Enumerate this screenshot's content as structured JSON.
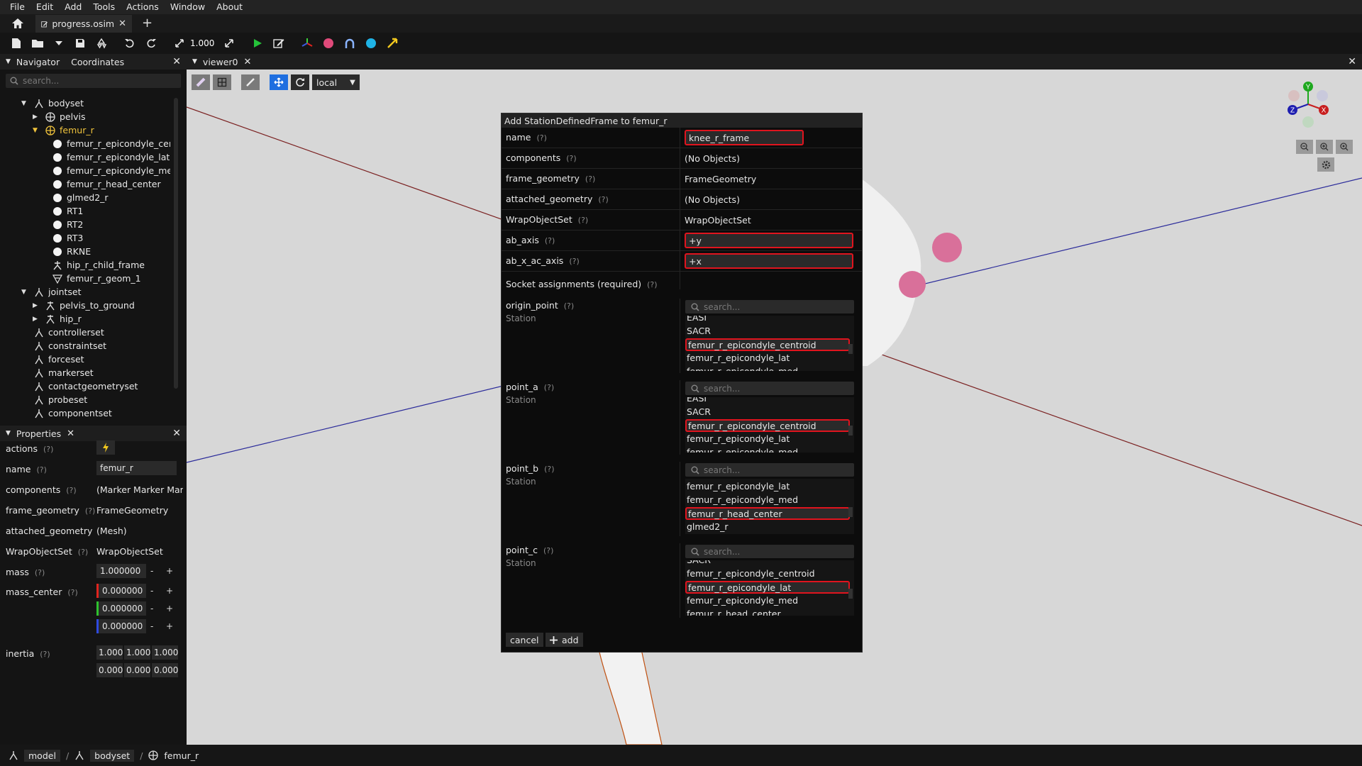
{
  "menu": [
    "File",
    "Edit",
    "Add",
    "Tools",
    "Actions",
    "Window",
    "About"
  ],
  "tab": {
    "name": "progress.osim"
  },
  "toolbar": {
    "scale_value": "1.000"
  },
  "navigator": {
    "title": "Navigator",
    "second_tab": "Coordinates",
    "search_placeholder": "search...",
    "tree": [
      {
        "label": "bodyset",
        "level": 0,
        "arrow": "down",
        "icon": "set"
      },
      {
        "label": "pelvis",
        "level": 1,
        "arrow": "right",
        "icon": "body"
      },
      {
        "label": "femur_r",
        "level": 1,
        "arrow": "down",
        "icon": "body",
        "selected": true
      },
      {
        "label": "femur_r_epicondyle_centroid",
        "level": 2,
        "icon": "marker"
      },
      {
        "label": "femur_r_epicondyle_lat",
        "level": 2,
        "icon": "marker"
      },
      {
        "label": "femur_r_epicondyle_med",
        "level": 2,
        "icon": "marker"
      },
      {
        "label": "femur_r_head_center",
        "level": 2,
        "icon": "marker"
      },
      {
        "label": "glmed2_r",
        "level": 2,
        "icon": "marker"
      },
      {
        "label": "RT1",
        "level": 2,
        "icon": "marker"
      },
      {
        "label": "RT2",
        "level": 2,
        "icon": "marker"
      },
      {
        "label": "RT3",
        "level": 2,
        "icon": "marker"
      },
      {
        "label": "RKNE",
        "level": 2,
        "icon": "marker"
      },
      {
        "label": "hip_r_child_frame",
        "level": 2,
        "icon": "frame"
      },
      {
        "label": "femur_r_geom_1",
        "level": 2,
        "icon": "mesh"
      },
      {
        "label": "jointset",
        "level": 0,
        "arrow": "down",
        "icon": "set"
      },
      {
        "label": "pelvis_to_ground",
        "level": 1,
        "arrow": "right",
        "icon": "joint"
      },
      {
        "label": "hip_r",
        "level": 1,
        "arrow": "right",
        "icon": "joint"
      },
      {
        "label": "controllerset",
        "level": 0,
        "icon": "set"
      },
      {
        "label": "constraintset",
        "level": 0,
        "icon": "set"
      },
      {
        "label": "forceset",
        "level": 0,
        "icon": "set"
      },
      {
        "label": "markerset",
        "level": 0,
        "icon": "set"
      },
      {
        "label": "contactgeometryset",
        "level": 0,
        "icon": "set"
      },
      {
        "label": "probeset",
        "level": 0,
        "icon": "set"
      },
      {
        "label": "componentset",
        "level": 0,
        "icon": "set"
      }
    ]
  },
  "properties": {
    "title": "Properties",
    "help": "(?)",
    "rows": {
      "actions": "actions",
      "name": "name",
      "name_value": "femur_r",
      "components": "components",
      "components_value": "(Marker Marker Mark",
      "frame_geometry": "frame_geometry",
      "frame_geometry_value": "FrameGeometry",
      "attached_geometry": "attached_geometry",
      "attached_geometry_value": "(Mesh)",
      "wrap": "WrapObjectSet",
      "wrap_value": "WrapObjectSet",
      "mass": "mass",
      "mass_value": "1.000000",
      "mass_center": "mass_center",
      "mc_x": "0.000000",
      "mc_y": "0.000000",
      "mc_z": "0.000000",
      "inertia": "inertia",
      "inertia_values": [
        "1.000",
        "1.000",
        "1.000",
        "0.000",
        "0.000",
        "0.000"
      ]
    },
    "minus": "-",
    "plus": "+"
  },
  "viewer": {
    "title": "viewer0",
    "frame_mode": "local"
  },
  "dialog": {
    "title": "Add StationDefinedFrame to femur_r",
    "help": "(?)",
    "fields": [
      {
        "label": "name",
        "value": "knee_r_frame",
        "input": true
      },
      {
        "label": "components",
        "value": "(No Objects)"
      },
      {
        "label": "frame_geometry",
        "value": "FrameGeometry"
      },
      {
        "label": "attached_geometry",
        "value": "(No Objects)"
      },
      {
        "label": "WrapObjectSet",
        "value": "WrapObjectSet"
      },
      {
        "label": "ab_axis",
        "value": "+y",
        "input": true
      },
      {
        "label": "ab_x_ac_axis",
        "value": "+x",
        "input": true
      }
    ],
    "socket_header": "Socket assignments (required)",
    "search_placeholder": "search...",
    "station_label": "Station",
    "sockets": [
      {
        "label": "origin_point",
        "items": [
          "EASI",
          "SACR",
          "femur_r_epicondyle_centroid",
          "femur_r_epicondyle_lat",
          "femur_r_epicondyle_med"
        ],
        "selected": 2,
        "offset": -6
      },
      {
        "label": "point_a",
        "items": [
          "EASI",
          "SACR",
          "femur_r_epicondyle_centroid",
          "femur_r_epicondyle_lat",
          "femur_r_epicondyle_med"
        ],
        "selected": 2,
        "offset": -7
      },
      {
        "label": "point_b",
        "items": [
          "femur_r_epicondyle_lat",
          "femur_r_epicondyle_med",
          "femur_r_head_center",
          "glmed2_r"
        ],
        "selected": 2,
        "offset": 2
      },
      {
        "label": "point_c",
        "items": [
          "SACR",
          "femur_r_epicondyle_centroid",
          "femur_r_epicondyle_lat",
          "femur_r_epicondyle_med",
          "femur_r_head_center"
        ],
        "selected": 2,
        "offset": -9
      }
    ],
    "cancel_label": "cancel",
    "add_label": "add"
  },
  "gizmo": {
    "x": "X",
    "y": "Y",
    "z": "Z"
  },
  "breadcrumb": [
    "model",
    "bodyset",
    "femur_r"
  ],
  "colors": {
    "selected_text": "#f0c33c",
    "highlight_border": "#e0141e",
    "viewer_bg": "#d7d7d7",
    "marker_pink": "#d9709a"
  }
}
